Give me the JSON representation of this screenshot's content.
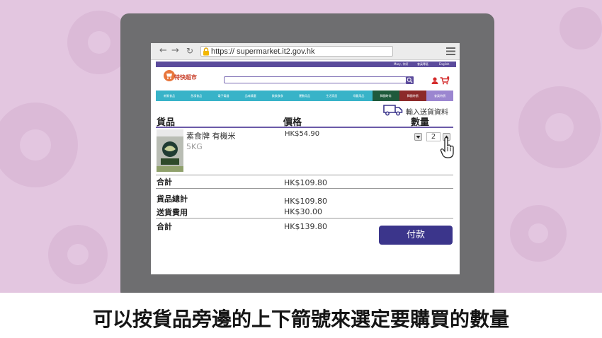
{
  "browser": {
    "url": "https:// supermarket.it2.gov.hk",
    "back_icon": "arrow-left-icon",
    "forward_icon": "arrow-right-icon",
    "reload_icon": "reload-icon",
    "lock_icon": "lock-icon",
    "menu_icon": "hamburger-menu-icon"
  },
  "site": {
    "util_links": [
      "Mary, 你好",
      "會員專區",
      "English"
    ],
    "logo_text": "特快超市",
    "categories": [
      "新鮮食品",
      "急凍食品",
      "電子電器",
      "品味精選",
      "飲飲食食",
      "運動用品",
      "生活家居",
      "母嬰用品",
      "韓國時尚",
      "韓國特價",
      "會員特價"
    ],
    "category_colors": [
      "#38b3c8",
      "#38b3c8",
      "#38b3c8",
      "#38b3c8",
      "#38b3c8",
      "#38b3c8",
      "#38b3c8",
      "#38b3c8",
      "#1e5a3c",
      "#8c2a2a",
      "#9b86d0"
    ],
    "accent": "#5b4b9c"
  },
  "cart": {
    "delivery_label": "輸入送貨資料",
    "headers": {
      "item": "貨品",
      "price": "價格",
      "qty": "數量"
    },
    "items": [
      {
        "name": "素食牌 有機米",
        "weight": "5KG",
        "price": "HK$54.90",
        "qty": "2"
      }
    ],
    "subtotal_label": "合計",
    "subtotal_value": "HK$109.80",
    "goods_total_label": "貨品總計",
    "goods_total_value": "HK$109.80",
    "shipping_label": "送貨費用",
    "shipping_value": "HK$30.00",
    "grand_total_label": "合計",
    "grand_total_value": "HK$139.80",
    "pay_label": "付款"
  },
  "subtitle": "可以按貨品旁邊的上下箭號來選定要購買的數量"
}
